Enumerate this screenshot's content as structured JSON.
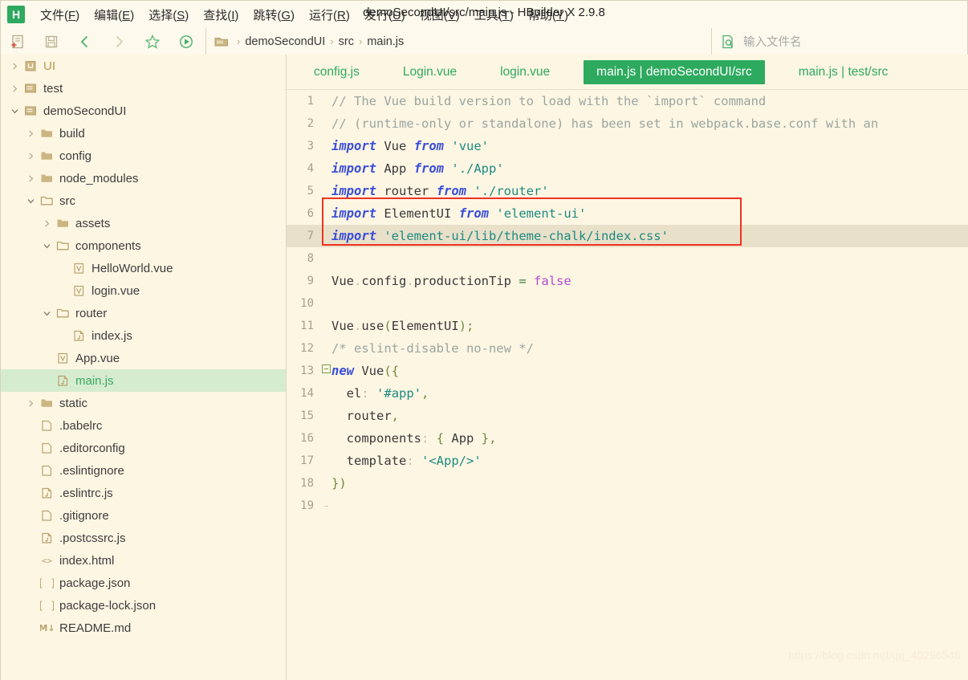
{
  "window": {
    "title": "demoSecondUI/src/main.js - HBuilder X 2.9.8",
    "logo_letter": "H"
  },
  "menubar": {
    "items": [
      {
        "label": "文件(F)",
        "mnemonic": "F"
      },
      {
        "label": "编辑(E)",
        "mnemonic": "E"
      },
      {
        "label": "选择(S)",
        "mnemonic": "S"
      },
      {
        "label": "查找(I)",
        "mnemonic": "I"
      },
      {
        "label": "跳转(G)",
        "mnemonic": "G"
      },
      {
        "label": "运行(R)",
        "mnemonic": "R"
      },
      {
        "label": "发行(U)",
        "mnemonic": "U"
      },
      {
        "label": "视图(V)",
        "mnemonic": "V"
      },
      {
        "label": "工具(T)",
        "mnemonic": "T"
      },
      {
        "label": "帮助(Y)",
        "mnemonic": "Y"
      }
    ]
  },
  "toolbar": {
    "buttons": [
      {
        "name": "new-file-icon"
      },
      {
        "name": "save-icon"
      },
      {
        "name": "back-arrow-icon"
      },
      {
        "name": "forward-arrow-icon"
      },
      {
        "name": "star-icon"
      },
      {
        "name": "run-icon"
      }
    ],
    "breadcrumb": [
      "demoSecondUI",
      "src",
      "main.js"
    ],
    "breadcrumb_separator": "›",
    "search_placeholder": "输入文件名"
  },
  "sidebar": {
    "tree": [
      {
        "label": "UI",
        "depth": 0,
        "twisty": "collapsed",
        "icon": "project-icon",
        "selected": false,
        "accent": true
      },
      {
        "label": "test",
        "depth": 0,
        "twisty": "collapsed",
        "icon": "project-folder-icon",
        "selected": false
      },
      {
        "label": "demoSecondUI",
        "depth": 0,
        "twisty": "expanded",
        "icon": "project-folder-icon",
        "selected": false
      },
      {
        "label": "build",
        "depth": 1,
        "twisty": "collapsed",
        "icon": "folder-closed-icon",
        "selected": false
      },
      {
        "label": "config",
        "depth": 1,
        "twisty": "collapsed",
        "icon": "folder-closed-icon",
        "selected": false
      },
      {
        "label": "node_modules",
        "depth": 1,
        "twisty": "collapsed",
        "icon": "folder-closed-icon",
        "selected": false
      },
      {
        "label": "src",
        "depth": 1,
        "twisty": "expanded",
        "icon": "folder-open-icon",
        "selected": false
      },
      {
        "label": "assets",
        "depth": 2,
        "twisty": "collapsed",
        "icon": "folder-closed-icon",
        "selected": false
      },
      {
        "label": "components",
        "depth": 2,
        "twisty": "expanded",
        "icon": "folder-open-icon",
        "selected": false
      },
      {
        "label": "HelloWorld.vue",
        "depth": 3,
        "twisty": "none",
        "icon": "vue-file-icon",
        "selected": false
      },
      {
        "label": "login.vue",
        "depth": 3,
        "twisty": "none",
        "icon": "vue-file-icon",
        "selected": false
      },
      {
        "label": "router",
        "depth": 2,
        "twisty": "expanded",
        "icon": "folder-open-icon",
        "selected": false
      },
      {
        "label": "index.js",
        "depth": 3,
        "twisty": "none",
        "icon": "js-file-icon",
        "selected": false
      },
      {
        "label": "App.vue",
        "depth": 2,
        "twisty": "none",
        "icon": "vue-file-icon",
        "selected": false
      },
      {
        "label": "main.js",
        "depth": 2,
        "twisty": "none",
        "icon": "js-file-icon",
        "selected": true
      },
      {
        "label": "static",
        "depth": 1,
        "twisty": "collapsed",
        "icon": "folder-closed-icon",
        "selected": false
      },
      {
        "label": ".babelrc",
        "depth": 1,
        "twisty": "none",
        "icon": "plain-file-icon",
        "selected": false
      },
      {
        "label": ".editorconfig",
        "depth": 1,
        "twisty": "none",
        "icon": "plain-file-icon",
        "selected": false
      },
      {
        "label": ".eslintignore",
        "depth": 1,
        "twisty": "none",
        "icon": "plain-file-icon",
        "selected": false
      },
      {
        "label": ".eslintrc.js",
        "depth": 1,
        "twisty": "none",
        "icon": "js-file-icon",
        "selected": false
      },
      {
        "label": ".gitignore",
        "depth": 1,
        "twisty": "none",
        "icon": "plain-file-icon",
        "selected": false
      },
      {
        "label": ".postcssrc.js",
        "depth": 1,
        "twisty": "none",
        "icon": "js-file-icon",
        "selected": false
      },
      {
        "label": "index.html",
        "depth": 1,
        "twisty": "none",
        "icon": "html-file-icon",
        "selected": false
      },
      {
        "label": "package.json",
        "depth": 1,
        "twisty": "none",
        "icon": "json-file-icon",
        "selected": false
      },
      {
        "label": "package-lock.json",
        "depth": 1,
        "twisty": "none",
        "icon": "json-file-icon",
        "selected": false
      },
      {
        "label": "README.md",
        "depth": 1,
        "twisty": "none",
        "icon": "markdown-file-icon",
        "selected": false
      }
    ]
  },
  "editor": {
    "tabs": [
      {
        "label": "config.js",
        "active": false
      },
      {
        "label": "Login.vue",
        "active": false
      },
      {
        "label": "login.vue",
        "active": false
      },
      {
        "label": "main.js | demoSecondUI/src",
        "active": true
      },
      {
        "label": "main.js | test/src",
        "active": false
      }
    ],
    "current_line": 7,
    "fold_line": 13,
    "highlight_box": {
      "from_line": 6,
      "to_line": 7,
      "color": "#ee3322"
    },
    "lines": [
      {
        "n": "1",
        "text": "// The Vue build version to load with the `import` command"
      },
      {
        "n": "2",
        "text": "// (runtime-only or standalone) has been set in webpack.base.conf with an"
      },
      {
        "n": "3",
        "text": "import Vue from 'vue'"
      },
      {
        "n": "4",
        "text": "import App from './App'"
      },
      {
        "n": "5",
        "text": "import router from './router'"
      },
      {
        "n": "6",
        "text": "import ElementUI from 'element-ui'"
      },
      {
        "n": "7",
        "text": "import 'element-ui/lib/theme-chalk/index.css'"
      },
      {
        "n": "8",
        "text": ""
      },
      {
        "n": "9",
        "text": "Vue.config.productionTip = false"
      },
      {
        "n": "10",
        "text": ""
      },
      {
        "n": "11",
        "text": "Vue.use(ElementUI);"
      },
      {
        "n": "12",
        "text": "/* eslint-disable no-new */"
      },
      {
        "n": "13",
        "text": "new Vue({"
      },
      {
        "n": "14",
        "text": "  el: '#app',"
      },
      {
        "n": "15",
        "text": "  router,"
      },
      {
        "n": "16",
        "text": "  components: { App },"
      },
      {
        "n": "17",
        "text": "  template: '<App/>'"
      },
      {
        "n": "18",
        "text": "})"
      },
      {
        "n": "19",
        "text": ""
      }
    ]
  },
  "watermark": "https://blog.csdn.net/qq_40296545",
  "colors": {
    "accent_green": "#2eaa5f",
    "editor_bg": "#fdf6e3",
    "current_line_bg": "#e8e0c9",
    "selection_bg": "#d6eccf",
    "highlight_red": "#ee3322"
  }
}
